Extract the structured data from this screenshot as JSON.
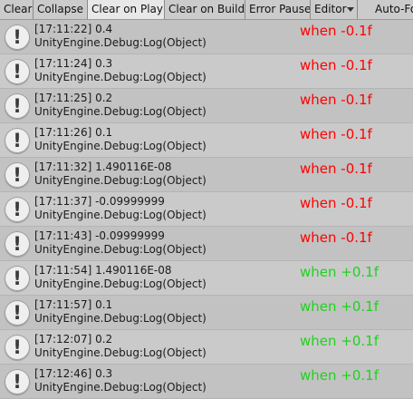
{
  "toolbar": {
    "clear": "Clear",
    "collapse": "Collapse",
    "clear_on_play": "Clear on Play",
    "clear_on_build": "Clear on Build",
    "error_pause": "Error Pause",
    "editor": "Editor",
    "auto_focus": "Auto-Fo"
  },
  "log_entries": [
    {
      "line1": "[17:11:22] 0.4",
      "line2": "UnityEngine.Debug:Log(Object)",
      "overlay": "when -0.1f"
    },
    {
      "line1": "[17:11:24] 0.3",
      "line2": "UnityEngine.Debug:Log(Object)",
      "overlay": "when -0.1f"
    },
    {
      "line1": "[17:11:25] 0.2",
      "line2": "UnityEngine.Debug:Log(Object)",
      "overlay": "when -0.1f"
    },
    {
      "line1": "[17:11:26] 0.1",
      "line2": "UnityEngine.Debug:Log(Object)",
      "overlay": "when -0.1f"
    },
    {
      "line1": "[17:11:32] 1.490116E-08",
      "line2": "UnityEngine.Debug:Log(Object)",
      "overlay": "when -0.1f"
    },
    {
      "line1": "[17:11:37] -0.09999999",
      "line2": "UnityEngine.Debug:Log(Object)",
      "overlay": "when -0.1f"
    },
    {
      "line1": "[17:11:43] -0.09999999",
      "line2": "UnityEngine.Debug:Log(Object)",
      "overlay": "when -0.1f"
    },
    {
      "line1": "[17:11:54] 1.490116E-08",
      "line2": "UnityEngine.Debug:Log(Object)",
      "overlay": "when +0.1f"
    },
    {
      "line1": "[17:11:57] 0.1",
      "line2": "UnityEngine.Debug:Log(Object)",
      "overlay": "when +0.1f"
    },
    {
      "line1": "[17:12:07] 0.2",
      "line2": "UnityEngine.Debug:Log(Object)",
      "overlay": "when +0.1f"
    },
    {
      "line1": "[17:12:46] 0.3",
      "line2": "UnityEngine.Debug:Log(Object)",
      "overlay": "when +0.1f"
    }
  ],
  "icon": {
    "glyph": "!",
    "name": "info-icon"
  },
  "colors": {
    "negative_note": "#ff0000",
    "positive_note": "#1fd21f"
  }
}
